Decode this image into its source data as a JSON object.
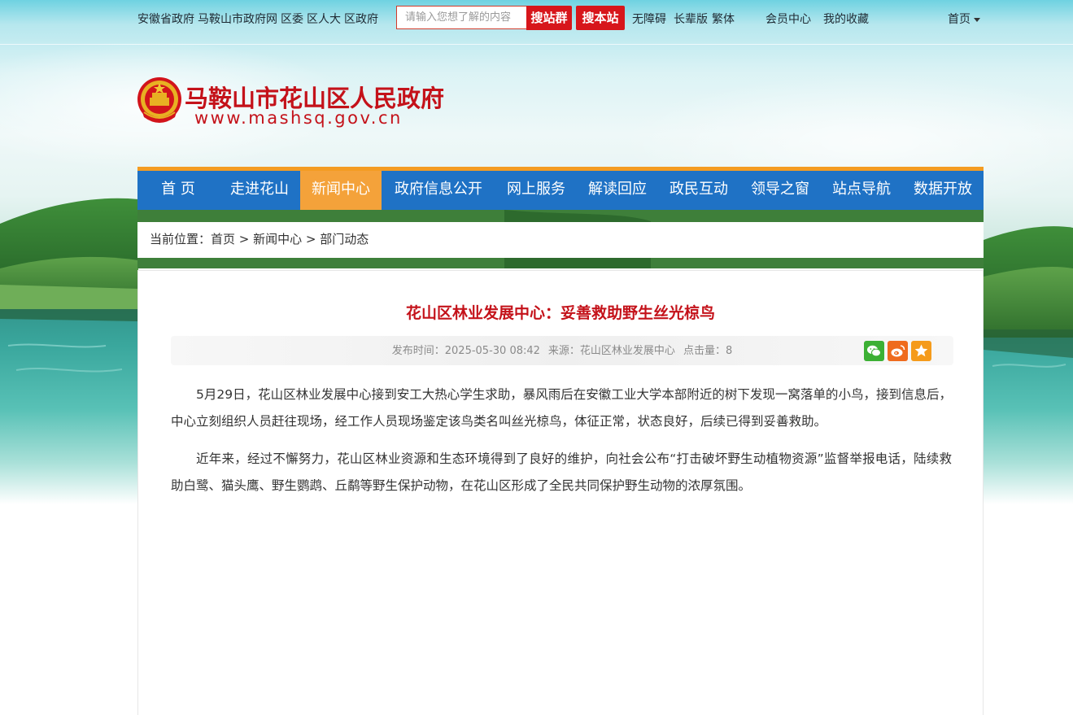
{
  "topbar": {
    "links": [
      "安徽省政府",
      "马鞍山市政府网",
      "区委",
      "区人大",
      "区政府"
    ],
    "search_placeholder": "请输入您想了解的内容",
    "search_group_label": "搜站群",
    "search_site_label": "搜本站",
    "accessibility_label": "无障碍",
    "elder_label": "长辈版",
    "traditional_label": "繁体",
    "member_label": "会员中心",
    "favorites_label": "我的收藏",
    "home_menu_label": "首页"
  },
  "logo": {
    "name": "马鞍山市花山区人民政府",
    "url": "www.mashsq.gov.cn"
  },
  "nav": {
    "items": [
      "首 页",
      "走进花山",
      "新闻中心",
      "政府信息公开",
      "网上服务",
      "解读回应",
      "政民互动",
      "领导之窗",
      "站点导航",
      "数据开放"
    ],
    "active_index": 2,
    "bar_color": "#1f72c5",
    "active_color": "#f4a23a",
    "accent_color": "#f49c22"
  },
  "breadcrumb": {
    "text": "当前位置：首页 > 新闻中心 > 部门动态"
  },
  "article": {
    "title": "花山区林业发展中心：妥善救助野生丝光椋鸟",
    "publish_time": "发布时间：2025-05-30 08:42",
    "source": "来源：花山区林业发展中心",
    "clicks": "点击量：8",
    "share_icons": [
      "wechat-icon",
      "weibo-icon",
      "favorite-star-icon"
    ],
    "paragraphs": [
      "5月29日，花山区林业发展中心接到安工大热心学生求助，暴风雨后在安徽工业大学本部附近的树下发现一窝落单的小鸟，接到信息后，中心立刻组织人员赶往现场，经工作人员现场鉴定该鸟类名叫丝光椋鸟，体征正常，状态良好，后续已得到妥善救助。",
      "近年来，经过不懈努力，花山区林业资源和生态环境得到了良好的维护，向社会公布“打击破坏野生动植物资源”监督举报电话，陆续救助白鹭、猫头鹰、野生鹦鹉、丘鹬等野生保护动物，在花山区形成了全民共同保护野生动物的浓厚氛围。"
    ],
    "title_color": "#c4121a"
  }
}
